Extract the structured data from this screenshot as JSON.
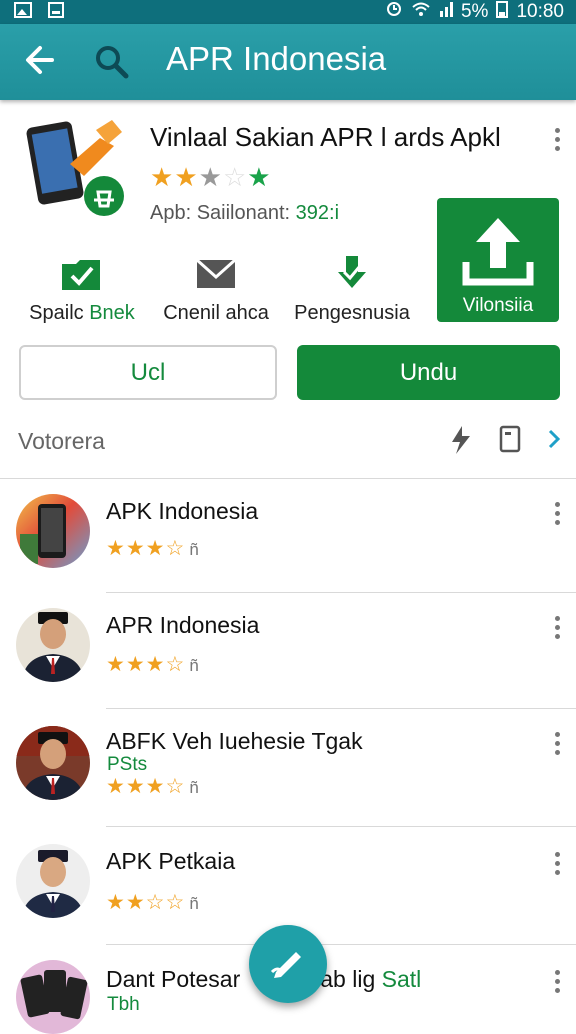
{
  "status_bar": {
    "battery": "5%",
    "time": "10:80"
  },
  "app_bar": {
    "title": "APR Indonesia"
  },
  "hero": {
    "title": "Vinlaal Sakian APR l ards Apkl",
    "rating": 2.5,
    "meta_label": "Apb: Saiilonant:",
    "meta_value": "392:i"
  },
  "actions": [
    {
      "label_a": "Spailc",
      "label_b": "Bnek",
      "icon": "folder-check-icon"
    },
    {
      "label_a": "Cnenil ahca",
      "label_b": "",
      "icon": "mail-icon"
    },
    {
      "label_a": "Pengesnusia",
      "label_b": "",
      "icon": "download-check-icon"
    }
  ],
  "upload_button": {
    "label": "Vilonsiia",
    "icon": "upload-icon"
  },
  "buttons": {
    "outline": "Ucl",
    "primary": "Undu"
  },
  "section": {
    "title": "Votorera"
  },
  "list": [
    {
      "title": "APK Indonesia",
      "sub": "",
      "stars": "★★★☆",
      "trail": "ñ",
      "avatar": "phone-scene"
    },
    {
      "title": "APR Indonesia",
      "sub": "",
      "stars": "★★★☆",
      "trail": "ñ",
      "avatar": "man-portrait"
    },
    {
      "title": "ABFK Veh Iuehesie Tgak",
      "sub": "PSts",
      "stars": "★★★☆",
      "trail": "ñ",
      "avatar": "man-portrait"
    },
    {
      "title": "APK Petkaia",
      "sub": "",
      "stars": "★★☆☆",
      "trail": "ñ",
      "avatar": "man-portrait"
    }
  ],
  "last_item": {
    "title_a": "Dant Potesar",
    "title_b": "ab lig",
    "title_c": "Satl",
    "sub": "Tbh"
  },
  "colors": {
    "primary": "#1f8f99",
    "accent_green": "#14893a",
    "star": "#f0a020"
  }
}
